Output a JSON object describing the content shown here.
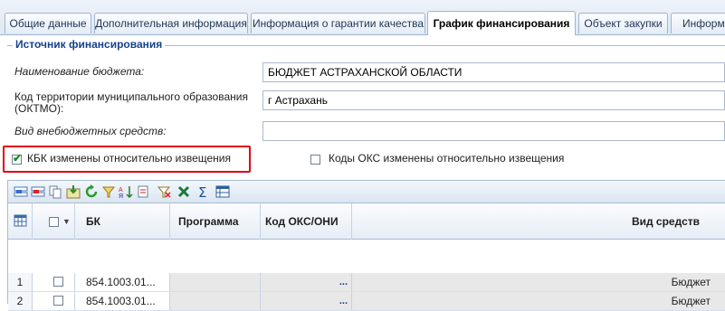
{
  "tabs": [
    {
      "label": "Общие данные"
    },
    {
      "label": "Дополнительная информация"
    },
    {
      "label": "Информация о гарантии качества"
    },
    {
      "label": "График финансирования"
    },
    {
      "label": "Объект закупки"
    },
    {
      "label": "Информа"
    }
  ],
  "section": {
    "title": "Источник финансирования"
  },
  "form": {
    "budget_label": "Наименование бюджета:",
    "budget_value": "БЮДЖЕТ АСТРАХАНСКОЙ ОБЛАСТИ",
    "oktmo_label_1": "Код территории муниципального образования",
    "oktmo_label_2": "(ОКТМО):",
    "oktmo_value": "г Астрахань",
    "extra_funds_label": "Вид внебюджетных средств:",
    "extra_funds_value": ""
  },
  "checkboxes": {
    "kbk_label": "КБК изменены относительно извещения",
    "kbk_checked": true,
    "oks_label": "Коды ОКС изменены относительно извещения",
    "oks_checked": false
  },
  "toolbar": {
    "icons": [
      "add-row-icon",
      "delete-row-icon",
      "copy-icon",
      "import-icon",
      "refresh-icon",
      "filter-icon",
      "sort-icon",
      "format-icon",
      "clear-filter-icon",
      "excel-export-icon",
      "sum-icon",
      "settings-table-icon"
    ]
  },
  "grid": {
    "headers": {
      "bk": "БК",
      "program": "Программа",
      "oks": "Код ОКС/ОНИ",
      "funds": "Вид средств"
    },
    "rows": [
      {
        "num": "1",
        "bk": "854.1003.01...",
        "program": "",
        "oks": "",
        "funds": "Бюджет"
      },
      {
        "num": "2",
        "bk": "854.1003.01...",
        "program": "",
        "oks": "",
        "funds": "Бюджет"
      }
    ],
    "ellipsis": "..."
  },
  "colors": {
    "accent": "#15428b",
    "highlight": "#e3000f",
    "check": "#1a8a1a"
  }
}
